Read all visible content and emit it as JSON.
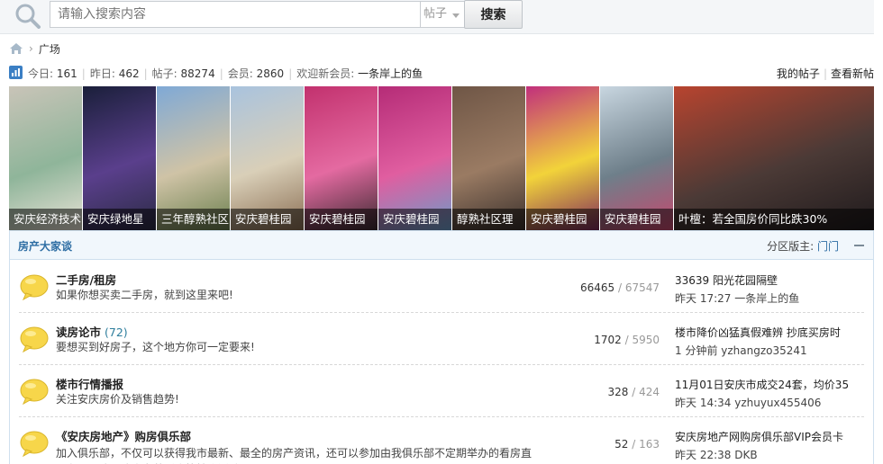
{
  "search": {
    "placeholder": "请输入搜索内容",
    "type": "帖子",
    "button": "搜索"
  },
  "breadcrumb": {
    "current": "广场"
  },
  "stats": {
    "today_label": "今日:",
    "today": "161",
    "yesterday_label": "昨日:",
    "yesterday": "462",
    "posts_label": "帖子:",
    "posts": "88274",
    "members_label": "会员:",
    "members": "2860",
    "welcome_label": "欢迎新会员:",
    "newest_member": "一条岸上的鱼",
    "my_posts": "我的帖子",
    "new_posts": "查看新帖"
  },
  "slides": [
    {
      "caption": "安庆经济技术",
      "colors": [
        "#c9c4b8",
        "#8fb59a",
        "#e8e2d6"
      ]
    },
    {
      "caption": "安庆绿地星",
      "colors": [
        "#1a1f3a",
        "#5a3f8c",
        "#2b2b44"
      ]
    },
    {
      "caption": "三年醇熟社区",
      "colors": [
        "#7fa9d6",
        "#cfc3a6",
        "#6a7f4e"
      ]
    },
    {
      "caption": "安庆碧桂园",
      "colors": [
        "#a9c3de",
        "#d9cfb8",
        "#8a6e53"
      ]
    },
    {
      "caption": "安庆碧桂园",
      "colors": [
        "#c2316e",
        "#e46aa1",
        "#3a2a30"
      ]
    },
    {
      "caption": "安庆碧桂园",
      "colors": [
        "#b52c77",
        "#e05ea0",
        "#6b9cc8"
      ]
    },
    {
      "caption": "醇熟社区理",
      "colors": [
        "#6f5646",
        "#9a7b63",
        "#3a302c"
      ]
    },
    {
      "caption": "安庆碧桂园",
      "colors": [
        "#c12f7c",
        "#f2d33a",
        "#7e2a5c"
      ]
    },
    {
      "caption": "安庆碧桂园",
      "colors": [
        "#c8d6e0",
        "#6e7f8a",
        "#c6486e"
      ]
    },
    {
      "caption": "叶檀：若全国房价同比跌30%",
      "colors": [
        "#b8442f",
        "#4b3a36",
        "#1f1a1c"
      ]
    }
  ],
  "category": {
    "title": "房产大家谈",
    "mod_label": "分区版主:",
    "mod_name": "门门"
  },
  "forums": [
    {
      "name": "二手房/租房",
      "today": "",
      "desc": "如果你想买卖二手房，就到这里来吧!",
      "threads": "66465",
      "posts": "67547",
      "last_title": "33639 阳光花园隔壁",
      "last_meta": "昨天 17:27 一条岸上的鱼"
    },
    {
      "name": "读房论市",
      "today": "(72)",
      "desc": "要想买到好房子，这个地方你可一定要来!",
      "threads": "1702",
      "posts": "5950",
      "last_title": "楼市降价凶猛真假难辨 抄底买房时",
      "last_meta": "1 分钟前 yzhangzo35241"
    },
    {
      "name": "楼市行情播报",
      "today": "",
      "desc": "关注安庆房价及销售趋势!",
      "threads": "328",
      "posts": "424",
      "last_title": "11月01日安庆市成交24套，均价35",
      "last_meta": "昨天 14:34 yzhuyux455406"
    },
    {
      "name": "《安庆房地产》购房俱乐部",
      "today": "",
      "desc": "加入俱乐部，不仅可以获得我市最新、最全的房产资讯，还可以参加由我俱乐部不定期举办的看房直通车、团购、购房者茶话会等精彩活动",
      "threads": "52",
      "posts": "163",
      "last_title": "安庆房地产网购房俱乐部VIP会员卡",
      "last_meta": "昨天 22:38 DKB"
    }
  ]
}
